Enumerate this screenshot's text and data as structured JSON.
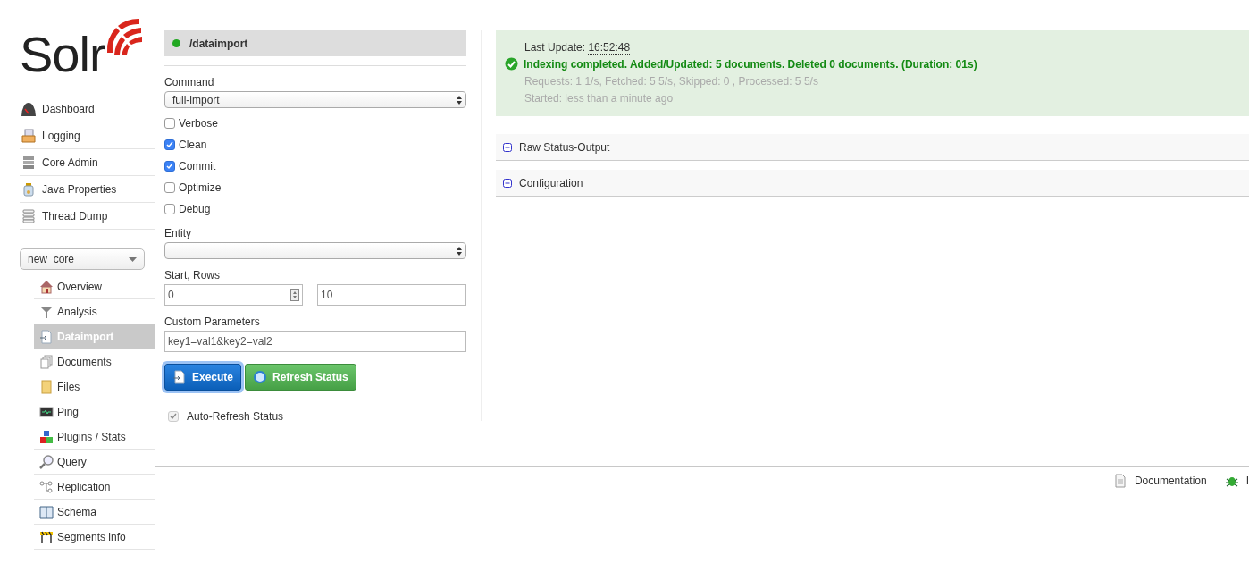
{
  "logo": {
    "text": "Solr"
  },
  "nav": [
    {
      "label": "Dashboard",
      "selected": false
    },
    {
      "label": "Logging",
      "selected": false
    },
    {
      "label": "Core Admin",
      "selected": false
    },
    {
      "label": "Java Properties",
      "selected": false
    },
    {
      "label": "Thread Dump",
      "selected": false
    }
  ],
  "core_selector": {
    "value": "new_core"
  },
  "core_nav": [
    {
      "label": "Overview",
      "selected": false
    },
    {
      "label": "Analysis",
      "selected": false
    },
    {
      "label": "Dataimport",
      "selected": true
    },
    {
      "label": "Documents",
      "selected": false
    },
    {
      "label": "Files",
      "selected": false
    },
    {
      "label": "Ping",
      "selected": false
    },
    {
      "label": "Plugins / Stats",
      "selected": false
    },
    {
      "label": "Query",
      "selected": false
    },
    {
      "label": "Replication",
      "selected": false
    },
    {
      "label": "Schema",
      "selected": false
    },
    {
      "label": "Segments info",
      "selected": false
    }
  ],
  "handler": {
    "title": "/dataimport"
  },
  "form": {
    "command_label": "Command",
    "command_value": "full-import",
    "options": [
      {
        "label": "Verbose",
        "checked": false
      },
      {
        "label": "Clean",
        "checked": true
      },
      {
        "label": "Commit",
        "checked": true
      },
      {
        "label": "Optimize",
        "checked": false
      },
      {
        "label": "Debug",
        "checked": false
      }
    ],
    "entity_label": "Entity",
    "start_rows_label": "Start, Rows",
    "start_value": "0",
    "rows_value": "10",
    "custom_label": "Custom Parameters",
    "custom_value": "key1=val1&key2=val2",
    "execute_button": "Execute",
    "refresh_button": "Refresh Status",
    "auto_refresh": {
      "label": "Auto-Refresh Status",
      "checked": true
    }
  },
  "status": {
    "last_update_label": "Last Update: ",
    "last_update_time": "16:52:48",
    "message": "Indexing completed. Added/Updated: 5 documents. Deleted 0 documents. (Duration: 01s)",
    "stats": [
      {
        "label": "Requests",
        "rest": ": 1 1/s, "
      },
      {
        "label": "Fetched",
        "rest": ": 5 5/s, "
      },
      {
        "label": "Skipped",
        "rest": ": 0 , "
      },
      {
        "label": "Processed",
        "rest": ": 5 5/s"
      }
    ],
    "started": {
      "label": "Started",
      "rest": ": less than a minute ago"
    }
  },
  "sections": [
    {
      "label": "Raw Status-Output",
      "expanded": true
    },
    {
      "label": "Configuration",
      "expanded": true
    }
  ],
  "footer": [
    {
      "label": "Documentation"
    },
    {
      "label": "I"
    }
  ]
}
